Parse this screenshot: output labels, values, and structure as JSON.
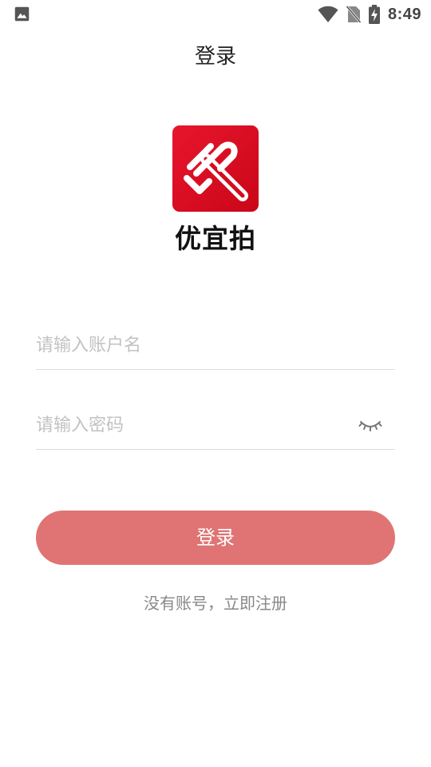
{
  "status_bar": {
    "time": "8:49",
    "icons": [
      "image-icon",
      "wifi-icon",
      "no-sim-icon",
      "battery-charging-icon"
    ]
  },
  "header": {
    "title": "登录"
  },
  "logo": {
    "brand_name": "优宜拍",
    "icon": "auction-hammer-logo",
    "brand_color": "#e0111f"
  },
  "form": {
    "username_placeholder": "请输入账户名",
    "password_placeholder": "请输入密码",
    "password_toggle_icon": "eye-closed-icon"
  },
  "login_button": {
    "label": "登录",
    "color": "#e07474"
  },
  "register_link": "没有账号，立即注册"
}
